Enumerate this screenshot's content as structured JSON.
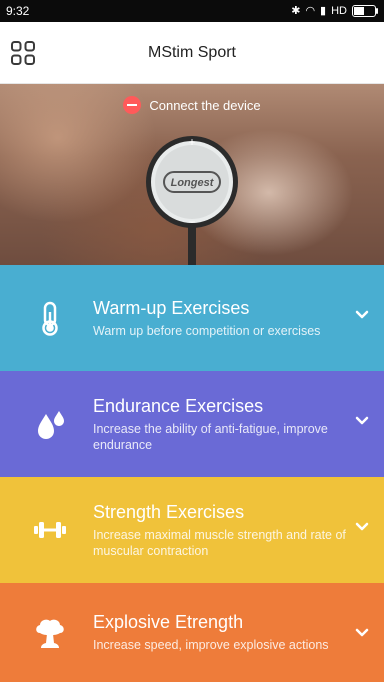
{
  "status_bar": {
    "time": "9:32",
    "network": "HD"
  },
  "app": {
    "title": "MStim Sport"
  },
  "hero": {
    "connect_label": "Connect the device",
    "device_brand": "Longest"
  },
  "exercises": [
    {
      "title": "Warm-up Exercises",
      "subtitle": "Warm up before competition or exercises",
      "icon": "thermometer-icon",
      "color": "#49aed1"
    },
    {
      "title": "Endurance Exercises",
      "subtitle": "Increase the ability of anti-fatigue, improve endurance",
      "icon": "water-drops-icon",
      "color": "#6a6ad6"
    },
    {
      "title": "Strength Exercises",
      "subtitle": "Increase maximal muscle strength and rate of muscular contraction",
      "icon": "dumbbell-icon",
      "color": "#f0c23a"
    },
    {
      "title": "Explosive Etrength",
      "subtitle": "Increase speed, improve explosive actions",
      "icon": "mushroom-cloud-icon",
      "color": "#ee7c3a"
    }
  ]
}
